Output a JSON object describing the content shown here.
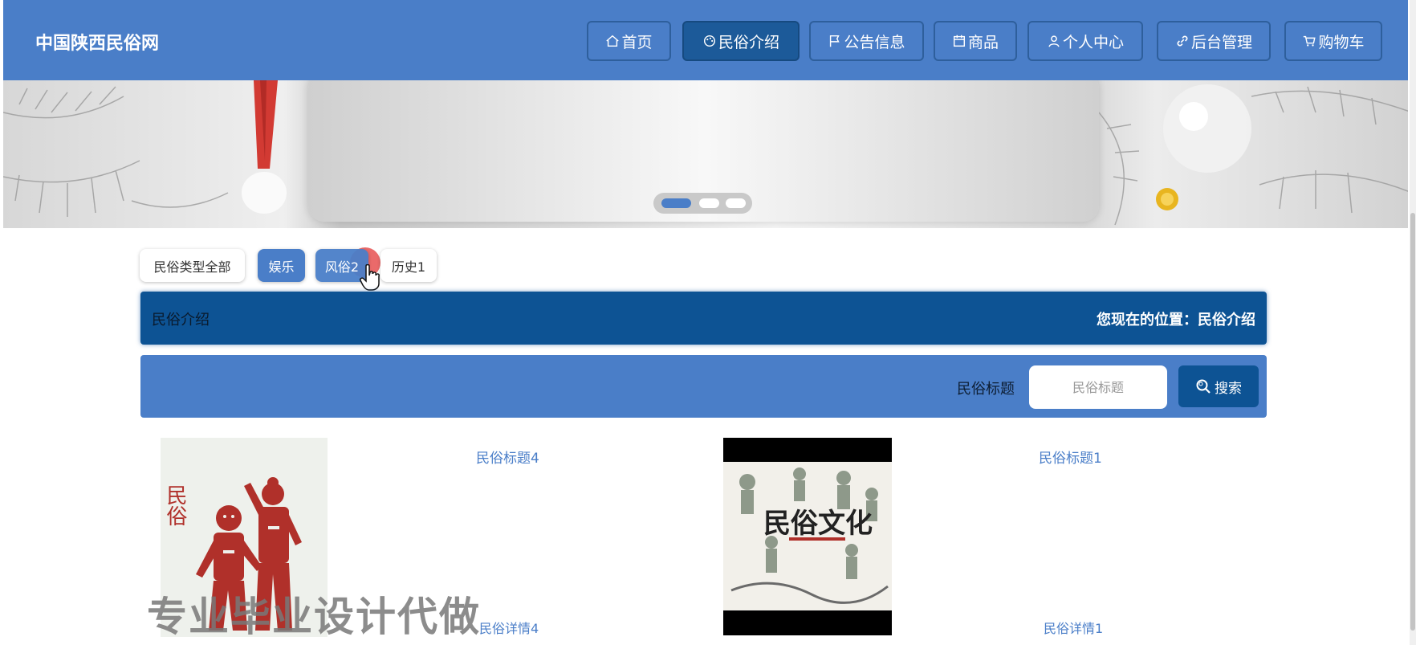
{
  "site": {
    "title": "中国陕西民俗网"
  },
  "nav": {
    "items": [
      {
        "label": "首页",
        "icon": "home-icon"
      },
      {
        "label": "民俗介绍",
        "icon": "palette-icon",
        "active": true
      },
      {
        "label": "公告信息",
        "icon": "flag-icon"
      },
      {
        "label": "商品",
        "icon": "calendar-icon"
      },
      {
        "label": "个人中心",
        "icon": "user-icon"
      },
      {
        "label": "后台管理",
        "icon": "link-icon"
      },
      {
        "label": "购物车",
        "icon": "cart-icon"
      }
    ]
  },
  "carousel": {
    "slide_count": 3,
    "active_index": 0
  },
  "categories": [
    {
      "label": "民俗类型全部",
      "selected": false
    },
    {
      "label": "娱乐",
      "selected": true
    },
    {
      "label": "风俗2",
      "selected": true
    },
    {
      "label": "历史1",
      "selected": false
    }
  ],
  "section": {
    "title": "民俗介绍",
    "breadcrumb": "您现在的位置：民俗介绍"
  },
  "search": {
    "label": "民俗标题",
    "placeholder": "民俗标题",
    "button_label": "搜索"
  },
  "items": [
    {
      "title": "民俗标题4",
      "detail": "民俗详情4",
      "image_caption": "民俗"
    },
    {
      "title": "民俗标题1",
      "detail": "民俗详情1",
      "image_caption": "民俗文化"
    }
  ],
  "watermark": "专业毕业设计代做",
  "colors": {
    "primary": "#4a7ec8",
    "dark": "#0d5394"
  }
}
